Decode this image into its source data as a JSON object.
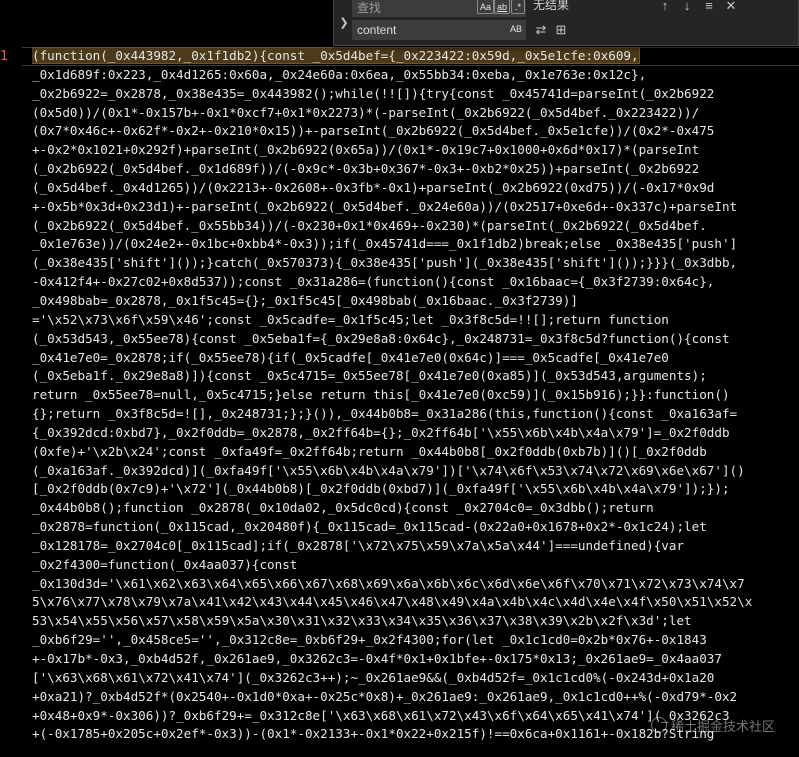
{
  "gutter": {
    "line_number": "1"
  },
  "find": {
    "search_value": "查找",
    "match_case_label": "Aa",
    "whole_word_label": "ab",
    "regex_label": ".*",
    "replace_value": "content",
    "preserve_case_label": "AB",
    "no_results": "无结果"
  },
  "code_lines": [
    "(function(_0x443982,_0x1f1db2){const _0x5d4bef={_0x223422:0x59d,_0x5e1cfe:0x609,",
    "_0x1d689f:0x223,_0x4d1265:0x60a,_0x24e60a:0x6ea,_0x55bb34:0xeba,_0x1e763e:0x12c},",
    "_0x2b6922=_0x2878,_0x38e435=_0x443982();while(!![]){try{const _0x45741d=parseInt(_0x2b6922",
    "(0x5d0))/(0x1*-0x157b+-0x1*0xcf7+0x1*0x2273)*(-parseInt(_0x2b6922(_0x5d4bef._0x223422))/",
    "(0x7*0x46c+-0x62f*-0x2+-0x210*0x15))+-parseInt(_0x2b6922(_0x5d4bef._0x5e1cfe))/(0x2*-0x475",
    "+-0x2*0x1021+0x292f)+parseInt(_0x2b6922(0x65a))/(0x1*-0x19c7+0x1000+0x6d*0x17)*(parseInt",
    "(_0x2b6922(_0x5d4bef._0x1d689f))/(-0x9c*-0x3b+0x367*-0x3+-0xb2*0x25))+parseInt(_0x2b6922",
    "(_0x5d4bef._0x4d1265))/(0x2213+-0x2608+-0x3fb*-0x1)+parseInt(_0x2b6922(0xd75))/(-0x17*0x9d",
    "+-0x5b*0x3d+0x23d1)+-parseInt(_0x2b6922(_0x5d4bef._0x24e60a))/(0x2517+0xe6d+-0x337c)+parseInt",
    "(_0x2b6922(_0x5d4bef._0x55bb34))/(-0x230+0x1*0x469+-0x230)*(parseInt(_0x2b6922(_0x5d4bef.",
    "_0x1e763e))/(0x24e2+-0x1bc+0xbb4*-0x3));if(_0x45741d===_0x1f1db2)break;else _0x38e435['push']",
    "(_0x38e435['shift']());}catch(_0x570373){_0x38e435['push'](_0x38e435['shift']());}}}(_0x3dbb,",
    "-0x412f4+-0x27c02+0x8d537));const _0x31a286=(function(){const _0x16baac={_0x3f2739:0x64c},",
    "_0x498bab=_0x2878,_0x1f5c45={};_0x1f5c45[_0x498bab(_0x16baac._0x3f2739)]",
    "='\\x52\\x73\\x6f\\x59\\x46';const _0x5cadfe=_0x1f5c45;let _0x3f8c5d=!![];return function",
    "(_0x53d543,_0x55ee78){const _0x5eba1f={_0x29e8a8:0x64c},_0x248731=_0x3f8c5d?function(){const",
    "_0x41e7e0=_0x2878;if(_0x55ee78){if(_0x5cadfe[_0x41e7e0(0x64c)]===_0x5cadfe[_0x41e7e0",
    "(_0x5eba1f._0x29e8a8)]){const _0x5c4715=_0x55ee78[_0x41e7e0(0xa85)](_0x53d543,arguments);",
    "return _0x55ee78=null,_0x5c4715;}else return this[_0x41e7e0(0xc59)](_0x15b916);}}:function()",
    "{};return _0x3f8c5d=![],_0x248731;};}()),_0x44b0b8=_0x31a286(this,function(){const _0xa163af=",
    "{_0x392dcd:0xbd7},_0x2f0ddb=_0x2878,_0x2ff64b={};_0x2ff64b['\\x55\\x6b\\x4b\\x4a\\x79']=_0x2f0ddb",
    "(0xfe)+'\\x2b\\x24';const _0xfa49f=_0x2ff64b;return _0x44b0b8[_0x2f0ddb(0xb7b)]()[_0x2f0ddb",
    "(_0xa163af._0x392dcd)](_0xfa49f['\\x55\\x6b\\x4b\\x4a\\x79'])['\\x74\\x6f\\x53\\x74\\x72\\x69\\x6e\\x67']()",
    "[_0x2f0ddb(0x7c9)+'\\x72'](_0x44b0b8)[_0x2f0ddb(0xbd7)](_0xfa49f['\\x55\\x6b\\x4b\\x4a\\x79']);});",
    "_0x44b0b8();function _0x2878(_0x10da02,_0x5dc0cd){const _0x2704c0=_0x3dbb();return",
    "_0x2878=function(_0x115cad,_0x20480f){_0x115cad=_0x115cad-(0x22a0+0x1678+0x2*-0x1c24);let",
    "_0x128178=_0x2704c0[_0x115cad];if(_0x2878['\\x72\\x75\\x59\\x7a\\x5a\\x44']===undefined){var",
    "_0x2f4300=function(_0x4aa037){const",
    "_0x130d3d='\\x61\\x62\\x63\\x64\\x65\\x66\\x67\\x68\\x69\\x6a\\x6b\\x6c\\x6d\\x6e\\x6f\\x70\\x71\\x72\\x73\\x74\\x7",
    "5\\x76\\x77\\x78\\x79\\x7a\\x41\\x42\\x43\\x44\\x45\\x46\\x47\\x48\\x49\\x4a\\x4b\\x4c\\x4d\\x4e\\x4f\\x50\\x51\\x52\\x",
    "53\\x54\\x55\\x56\\x57\\x58\\x59\\x5a\\x30\\x31\\x32\\x33\\x34\\x35\\x36\\x37\\x38\\x39\\x2b\\x2f\\x3d';let",
    "_0xb6f29='',_0x458ce5='',_0x312c8e=_0xb6f29+_0x2f4300;for(let _0x1c1cd0=0x2b*0x76+-0x1843",
    "+-0x17b*-0x3,_0xb4d52f,_0x261ae9,_0x3262c3=-0x4f*0x1+0x1bfe+-0x175*0x13;_0x261ae9=_0x4aa037",
    "['\\x63\\x68\\x61\\x72\\x41\\x74'](_0x3262c3++);~_0x261ae9&&(_0xb4d52f=_0x1c1cd0%(-0x243d+0x1a20",
    "+0xa21)?_0xb4d52f*(0x2540+-0x1d0*0xa+-0x25c*0x8)+_0x261ae9:_0x261ae9,_0x1c1cd0++%(-0xd79*-0x2",
    "+0x48+0x9*-0x306))?_0xb6f29+=_0x312c8e['\\x63\\x68\\x61\\x72\\x43\\x6f\\x64\\x65\\x41\\x74'](_0x3262c3",
    "+(-0x1785+0x205c+0x2ef*-0x3))-(0x1*-0x2133+-0x1*0x22+0x215f)!==0x6ca+0x1161+-0x182b?String"
  ],
  "watermark": "稀土掘金技术社区",
  "tip": "String"
}
